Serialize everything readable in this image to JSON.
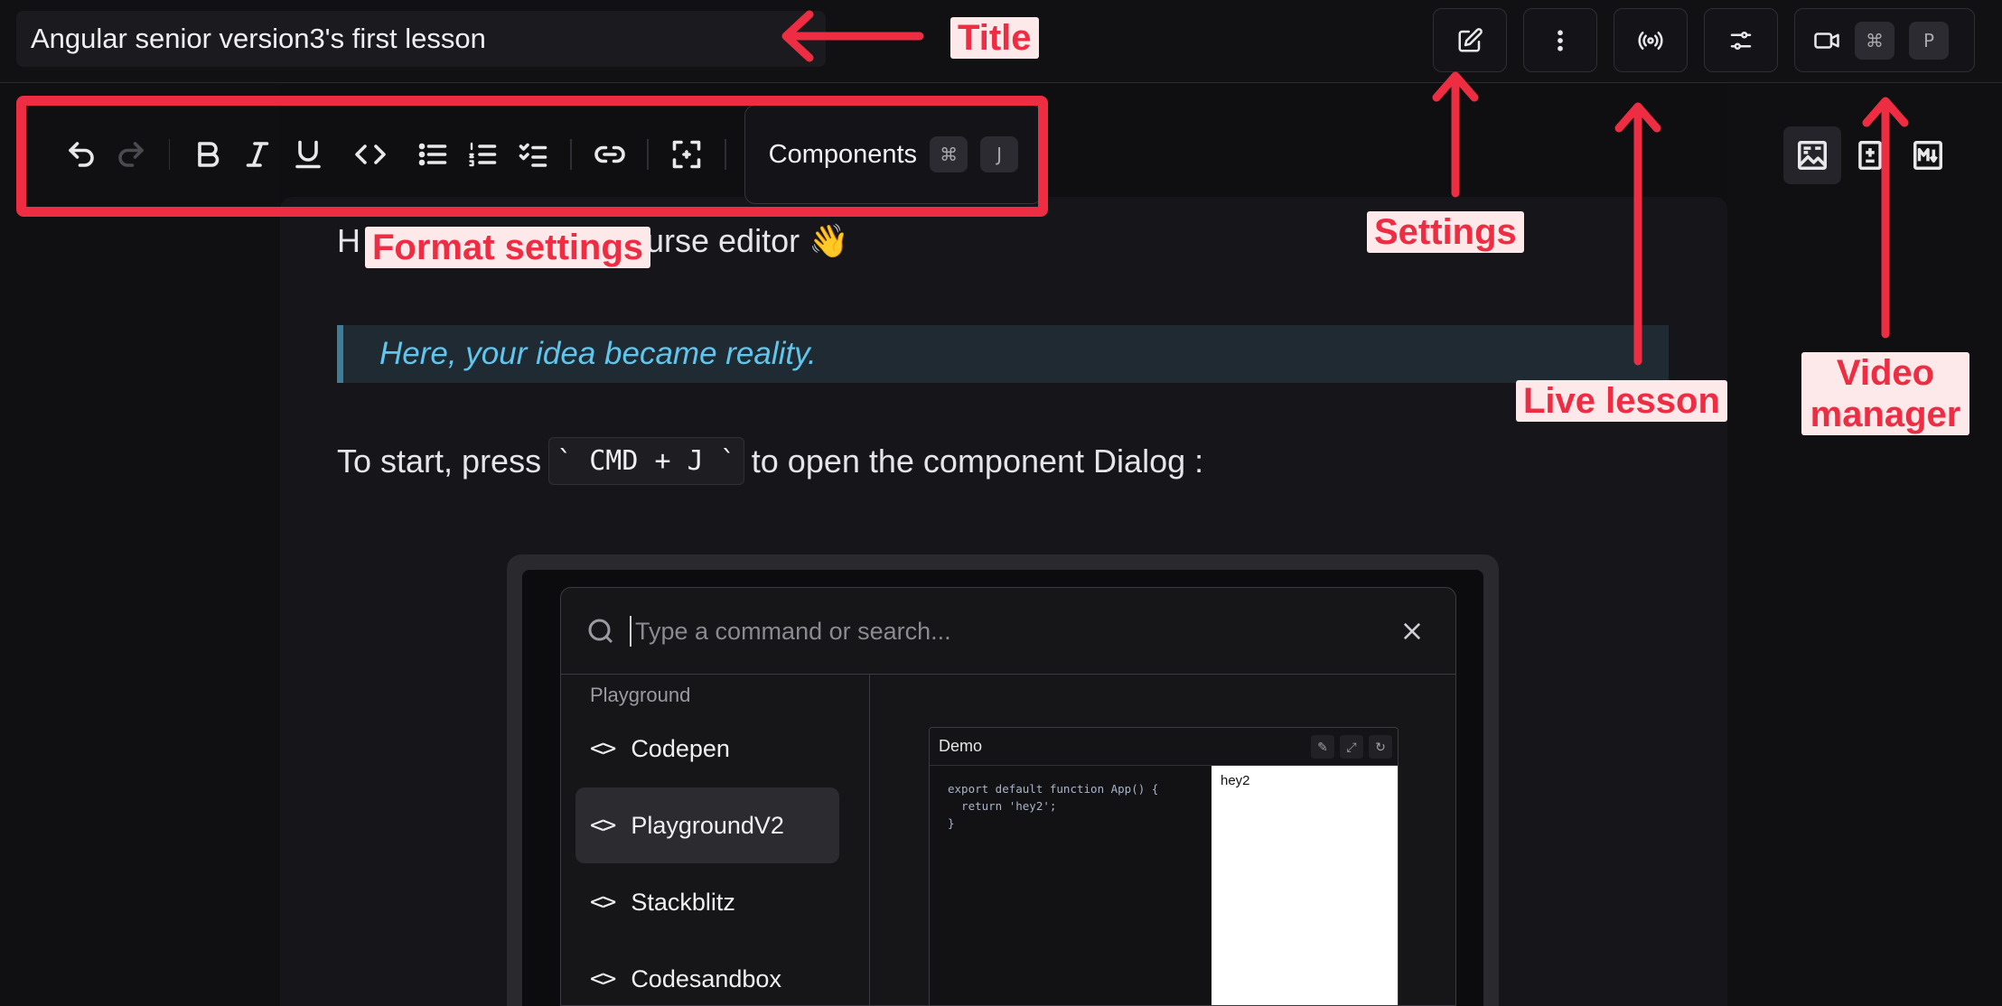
{
  "header": {
    "title": "Angular senior version3's first lesson",
    "buttons": [
      {
        "name": "edit",
        "icon": "edit-icon"
      },
      {
        "name": "more",
        "icon": "more-vertical-icon"
      },
      {
        "name": "live",
        "icon": "broadcast-icon"
      },
      {
        "name": "settings",
        "icon": "sliders-icon"
      },
      {
        "name": "video",
        "icon": "video-camera-icon"
      }
    ],
    "video_shortcut": {
      "cmd": "⌘",
      "key": "P"
    }
  },
  "toolbar": {
    "tools": [
      "undo",
      "redo",
      "bold",
      "italic",
      "underline",
      "code",
      "bullet-list",
      "ordered-list",
      "task-list",
      "link",
      "fullscreen"
    ],
    "components_label": "Components",
    "components_shortcut": {
      "cmd": "⌘",
      "key": "J"
    }
  },
  "view_toggles": [
    "rich-text-view-icon",
    "diff-view-icon",
    "markdown-view-icon"
  ],
  "content": {
    "heading_start": "H",
    "heading_end": "urse editor 👋",
    "quote": "Here, your idea became reality.",
    "instruction_before": "To start, press",
    "instruction_code": "` CMD + J `",
    "instruction_after": "to open the component Dialog :"
  },
  "dialog_screenshot": {
    "search_placeholder": "Type a command or search...",
    "group_title": "Playground",
    "items": [
      "Codepen",
      "PlaygroundV2",
      "Stackblitz",
      "Codesandbox"
    ],
    "selected_item": "PlaygroundV2",
    "demo": {
      "title": "Demo",
      "code": "export default function App() {\n  return 'hey2';\n}",
      "output": "hey2"
    }
  },
  "annotations": {
    "title": "Title",
    "format": "Format settings",
    "settings": "Settings",
    "live": "Live lesson",
    "video": "Video manager",
    "color": "#ee2d43",
    "label_bg": "#fde8ea"
  }
}
